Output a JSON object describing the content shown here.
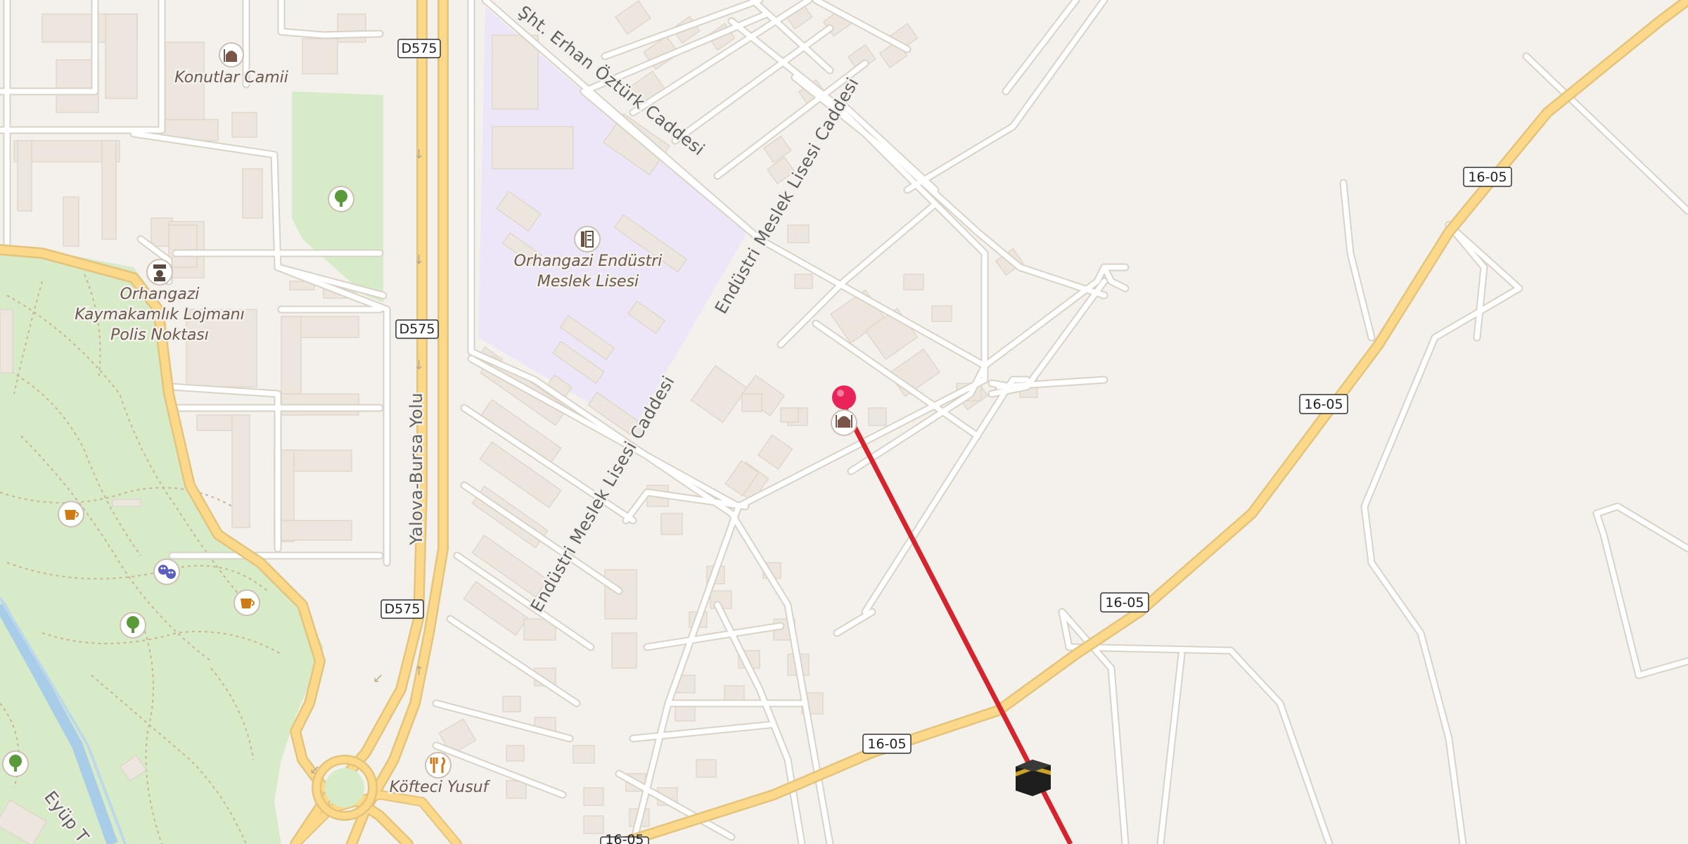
{
  "colors": {
    "land": "#f4f1ec",
    "park": "#d8ebc8",
    "school_area": "#ece6f8",
    "road": "#ffffff",
    "primary_road": "#fbd88a",
    "river": "#a9cce8",
    "route_line": "#d6242f",
    "pin": "#e8245a"
  },
  "roads": {
    "d575_a": "D575",
    "d575_b": "D575",
    "d575_c": "D575",
    "r1605_a": "16-05",
    "r1605_b": "16-05",
    "r1605_c": "16-05",
    "r1605_d": "16-05",
    "r1605_e": "16-05"
  },
  "streets": {
    "yalova_bursa_yolu": "Yalova-Bursa Yolu",
    "sht_erhan": "Şht. Erhan Öztürk Caddesi",
    "endustri_meslek_1": "Endüstri Meslek Lisesi Caddesi",
    "endustri_meslek_2": "Endüstri Meslek Lisesi Caddesi",
    "eyup": "Eyüp T"
  },
  "pois": {
    "konutlar_camii": {
      "label": "Konutlar Camii",
      "icon": "mosque-icon"
    },
    "school": {
      "label_line1": "Orhangazi Endüstri",
      "label_line2": "Meslek Lisesi",
      "icon": "school-icon"
    },
    "police": {
      "label_line1": "Orhangazi",
      "label_line2": "Kaymakamlık Lojmanı",
      "label_line3": "Polis Noktası",
      "icon": "police-icon"
    },
    "kofteci": {
      "label": "Köfteci Yusuf",
      "icon": "restaurant-icon"
    },
    "cafe_1": {
      "icon": "cafe-icon"
    },
    "cafe_2": {
      "icon": "cafe-icon"
    },
    "theatre": {
      "icon": "theatre-icon"
    },
    "park_tree_1": {
      "icon": "tree-icon"
    },
    "park_tree_2": {
      "icon": "tree-icon"
    },
    "park_tree_3": {
      "icon": "tree-icon"
    },
    "selected_place": {
      "icon": "mosque-icon"
    },
    "kaaba": {
      "icon": "kaaba-icon"
    },
    "pin": {
      "icon": "location-pin-icon"
    }
  }
}
